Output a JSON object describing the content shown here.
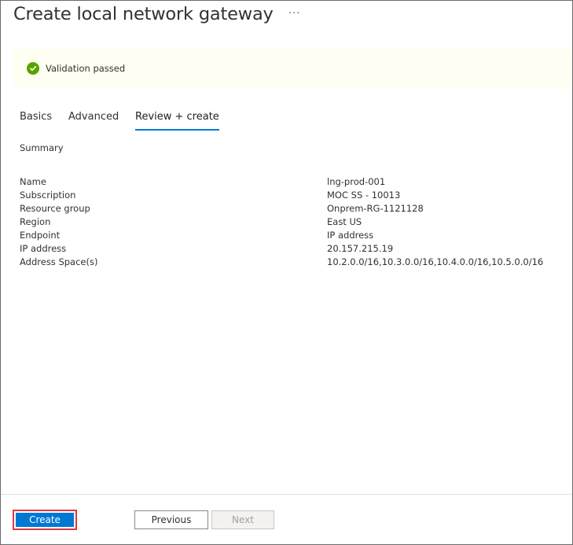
{
  "header": {
    "title": "Create local network gateway",
    "more_label": "···"
  },
  "banner": {
    "text": "Validation passed",
    "icon": "checkmark-circle-icon",
    "color": "#57a300"
  },
  "tabs": [
    {
      "label": "Basics",
      "active": false
    },
    {
      "label": "Advanced",
      "active": false
    },
    {
      "label": "Review + create",
      "active": true
    }
  ],
  "summary": {
    "heading": "Summary",
    "rows": [
      {
        "key": "Name",
        "value": "lng-prod-001"
      },
      {
        "key": "Subscription",
        "value": "MOC SS - 10013"
      },
      {
        "key": "Resource group",
        "value": "Onprem-RG-1121128"
      },
      {
        "key": "Region",
        "value": "East US"
      },
      {
        "key": "Endpoint",
        "value": "IP address"
      },
      {
        "key": "IP address",
        "value": "20.157.215.19"
      },
      {
        "key": "Address Space(s)",
        "value": "10.2.0.0/16,10.3.0.0/16,10.4.0.0/16,10.5.0.0/16"
      }
    ]
  },
  "footer": {
    "create_label": "Create",
    "previous_label": "Previous",
    "next_label": "Next"
  },
  "colors": {
    "accent": "#0078d4",
    "highlight": "#e0393e"
  }
}
